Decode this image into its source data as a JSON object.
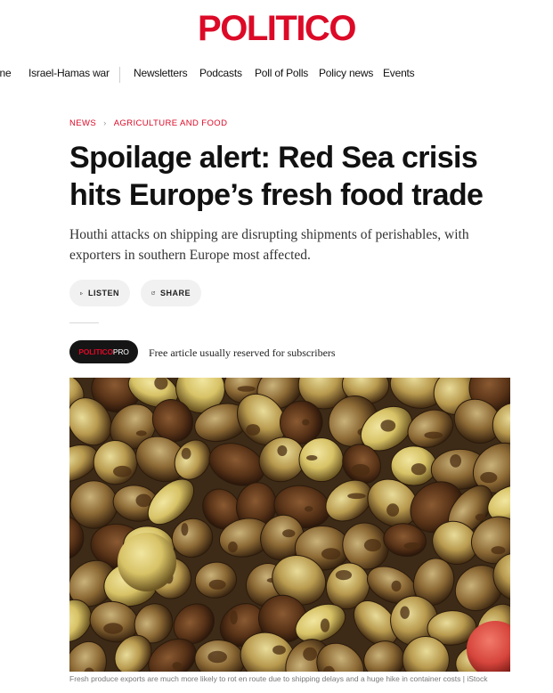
{
  "brand": {
    "logo_text": "POLITICO",
    "color": "#dc0a27"
  },
  "nav": {
    "items": [
      "ine",
      "Israel-Hamas war",
      "Newsletters",
      "Podcasts",
      "Poll of Polls",
      "Policy news",
      "Events"
    ]
  },
  "article": {
    "breadcrumb": [
      "NEWS",
      "AGRICULTURE AND FOOD"
    ],
    "headline_line1": "Spoilage alert: Red Sea crisis",
    "headline_line2": "hits Europe’s fresh food trade",
    "dek_line1": "Houthi attacks on shipping are disrupting shipments of perishables, with",
    "dek_line2": "exporters in southern Europe most affected.",
    "actions": {
      "listen": "LISTEN",
      "share": "SHARE"
    },
    "pro_badge": {
      "part1": "POLITICO",
      "part2": "PRO"
    },
    "pro_note": "Free article usually reserved for subscribers",
    "caption": "Fresh produce exports are much more likely to rot en route due to shipping delays and a huge hike in container costs | iStock"
  },
  "icons": {
    "listen": "play-icon",
    "share": "share-icon"
  }
}
